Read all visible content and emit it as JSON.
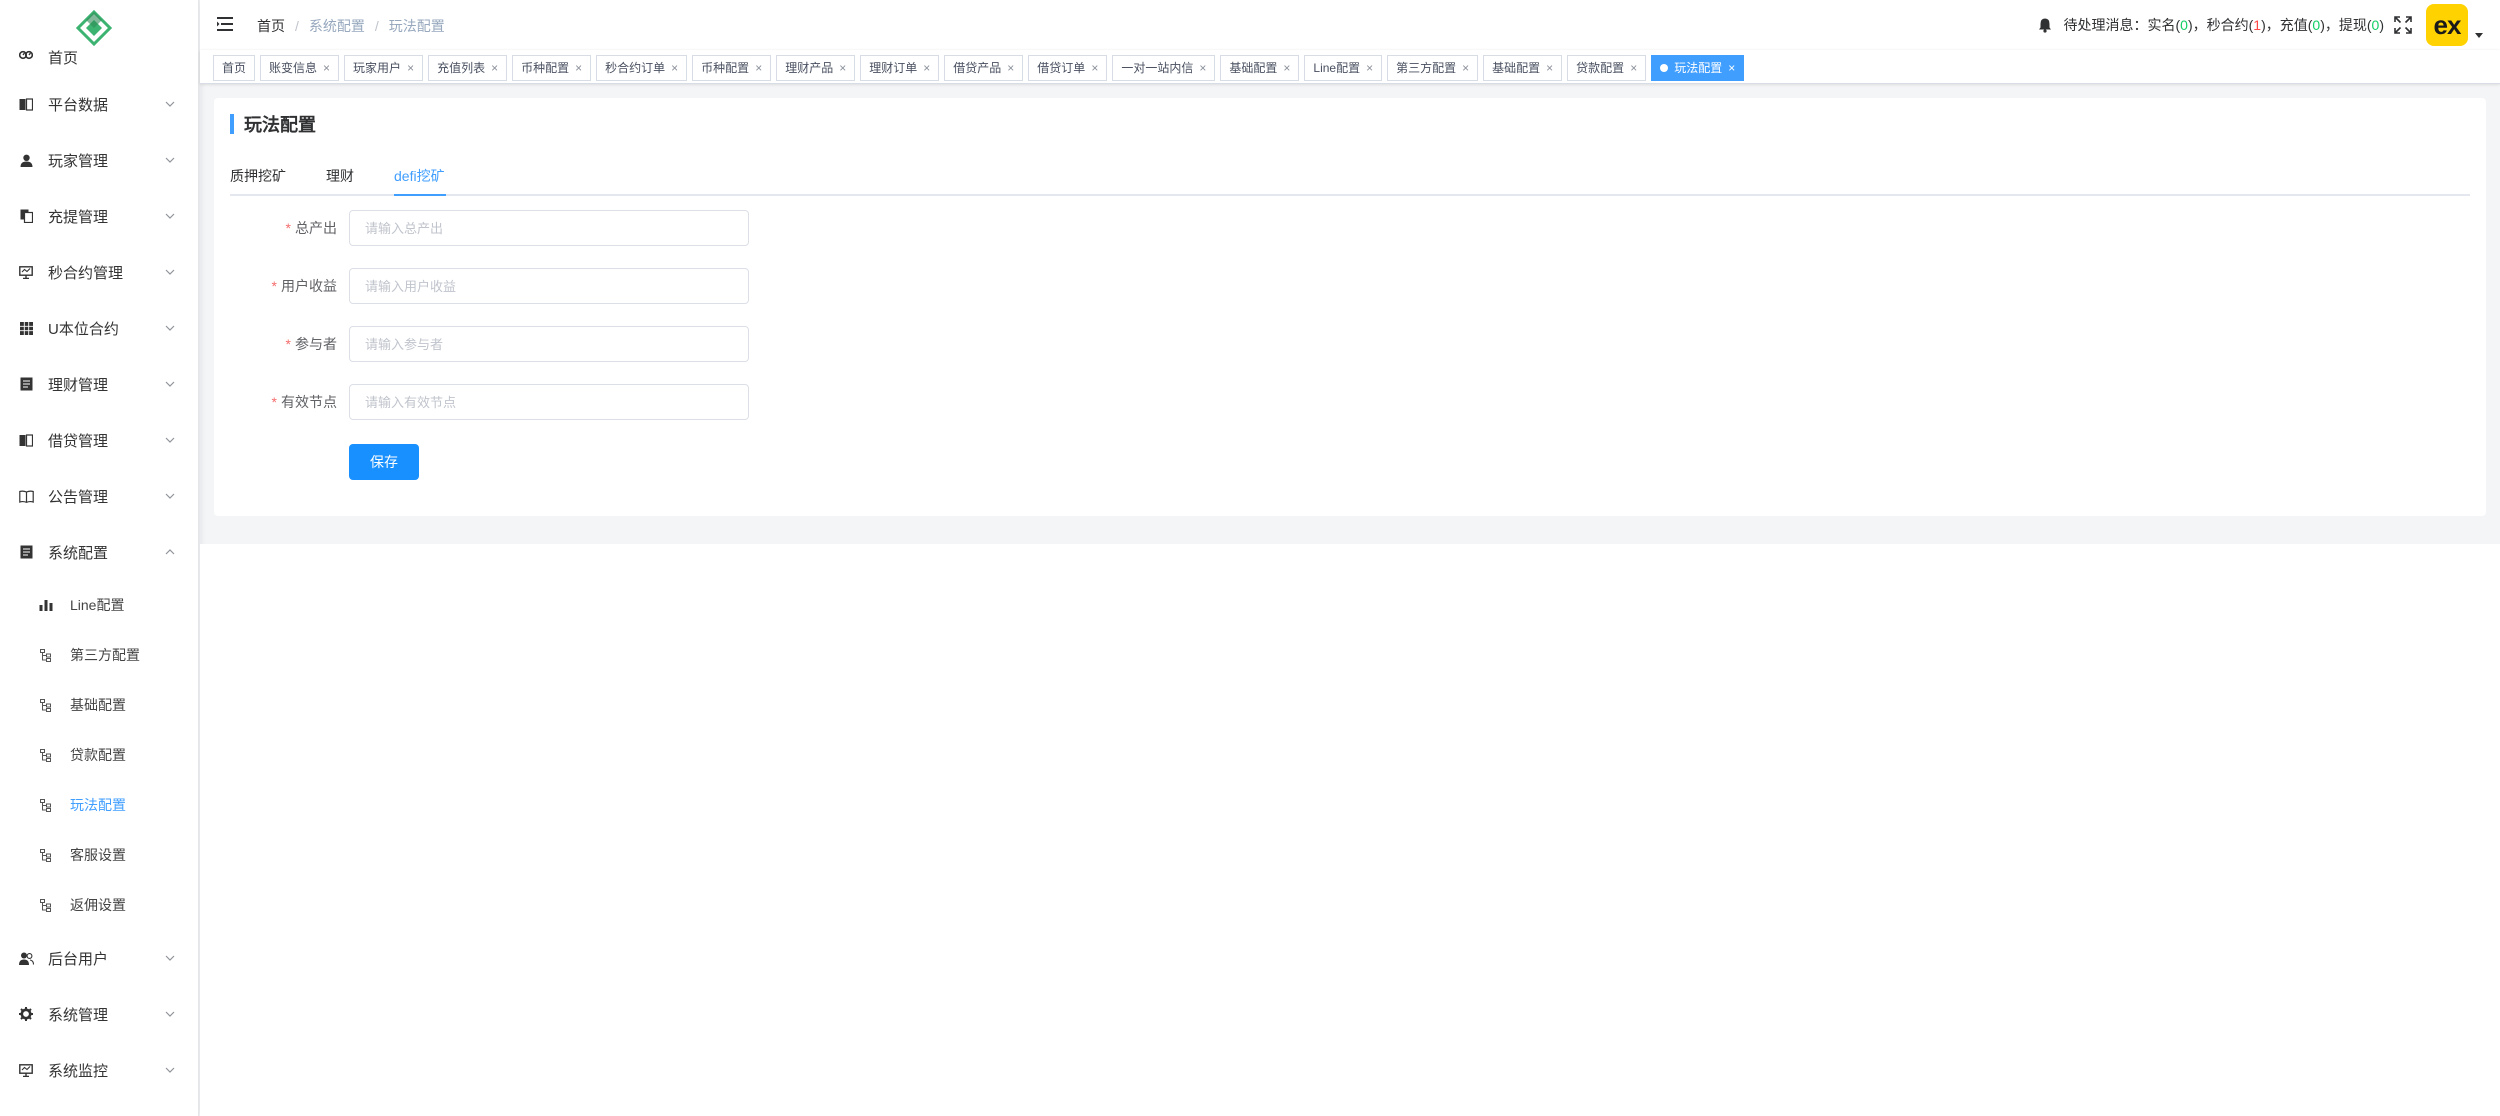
{
  "colors": {
    "accent": "#409eff",
    "primary_button": "#1890ff",
    "required": "#f56c6c",
    "avatar_bg": "#ffd200"
  },
  "sidebar": {
    "logo": "logo-icon",
    "items": [
      {
        "label": "首页",
        "icon": "dashboard-icon"
      },
      {
        "label": "平台数据",
        "icon": "book-icon"
      },
      {
        "label": "玩家管理",
        "icon": "user-icon"
      },
      {
        "label": "充提管理",
        "icon": "copy-icon"
      },
      {
        "label": "秒合约管理",
        "icon": "monitor-icon"
      },
      {
        "label": "U本位合约",
        "icon": "grid-icon"
      },
      {
        "label": "理财管理",
        "icon": "document-icon"
      },
      {
        "label": "借贷管理",
        "icon": "book-icon"
      },
      {
        "label": "公告管理",
        "icon": "open-book-icon"
      },
      {
        "label": "系统配置",
        "icon": "document-icon"
      }
    ],
    "sub_items": [
      {
        "label": "Line配置",
        "icon": "bar-chart-icon"
      },
      {
        "label": "第三方配置",
        "icon": "tree-icon"
      },
      {
        "label": "基础配置",
        "icon": "tree-icon"
      },
      {
        "label": "贷款配置",
        "icon": "tree-icon"
      },
      {
        "label": "玩法配置",
        "icon": "tree-icon"
      },
      {
        "label": "客服设置",
        "icon": "tree-icon"
      },
      {
        "label": "返佣设置",
        "icon": "tree-icon"
      }
    ],
    "bottom_items": [
      {
        "label": "后台用户",
        "icon": "peoples-icon"
      },
      {
        "label": "系统管理",
        "icon": "gear-icon"
      },
      {
        "label": "系统监控",
        "icon": "monitor-icon"
      }
    ]
  },
  "header": {
    "breadcrumb": [
      "首页",
      "系统配置",
      "玩法配置"
    ],
    "breadcrumb_sep": "/",
    "notice": {
      "prefix": "待处理消息：实名(",
      "realname": "0",
      "p2": ")，秒合约(",
      "contract": "1",
      "p3": ")，充值(",
      "recharge": "0",
      "p4": ")，提现(",
      "withdraw": "0",
      "suffix": ")"
    },
    "avatar_text": "ex"
  },
  "tags": [
    {
      "label": "首页",
      "closable": false
    },
    {
      "label": "账变信息",
      "closable": true
    },
    {
      "label": "玩家用户",
      "closable": true
    },
    {
      "label": "充值列表",
      "closable": true
    },
    {
      "label": "币种配置",
      "closable": true
    },
    {
      "label": "秒合约订单",
      "closable": true
    },
    {
      "label": "币种配置",
      "closable": true
    },
    {
      "label": "理财产品",
      "closable": true
    },
    {
      "label": "理财订单",
      "closable": true
    },
    {
      "label": "借贷产品",
      "closable": true
    },
    {
      "label": "借贷订单",
      "closable": true
    },
    {
      "label": "一对一站内信",
      "closable": true
    },
    {
      "label": "基础配置",
      "closable": true
    },
    {
      "label": "Line配置",
      "closable": true
    },
    {
      "label": "第三方配置",
      "closable": true
    },
    {
      "label": "基础配置",
      "closable": true
    },
    {
      "label": "贷款配置",
      "closable": true
    },
    {
      "label": "玩法配置",
      "closable": true,
      "active": true
    }
  ],
  "tag_close": "×",
  "main": {
    "title": "玩法配置",
    "tabs": [
      "质押挖矿",
      "理财",
      "defi挖矿"
    ],
    "active_tab": 2,
    "form": {
      "required_mark": "*",
      "fields": [
        {
          "label": "总产出",
          "placeholder": "请输入总产出",
          "value": ""
        },
        {
          "label": "用户收益",
          "placeholder": "请输入用户收益",
          "value": ""
        },
        {
          "label": "参与者",
          "placeholder": "请输入参与者",
          "value": ""
        },
        {
          "label": "有效节点",
          "placeholder": "请输入有效节点",
          "value": ""
        }
      ],
      "save_label": "保存"
    }
  }
}
